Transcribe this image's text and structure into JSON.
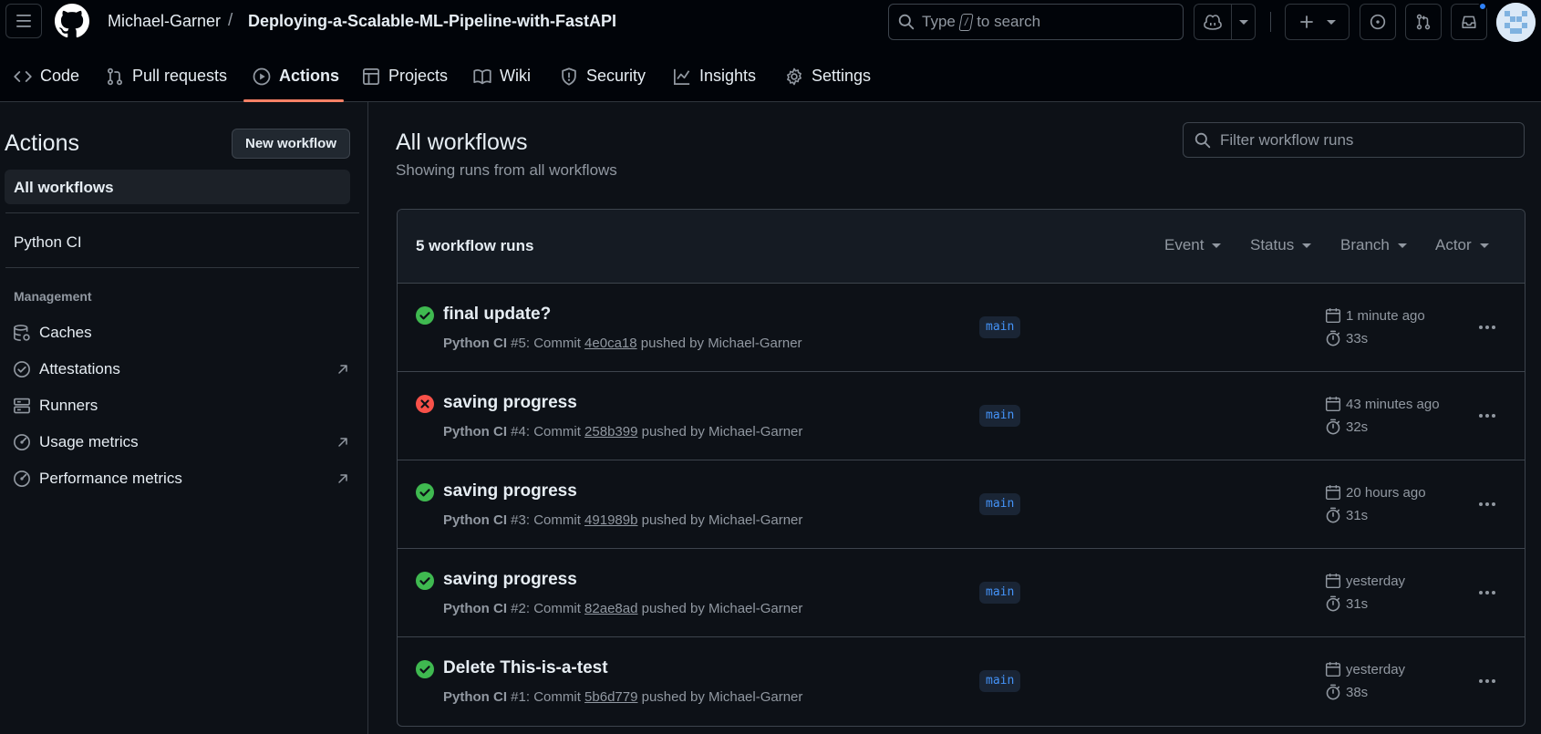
{
  "header": {
    "owner": "Michael-Garner",
    "separator": "/",
    "repo": "Deploying-a-Scalable-ML-Pipeline-with-FastAPI",
    "search": {
      "prefix": "Type",
      "key": "/",
      "suffix": "to search"
    }
  },
  "tabs": [
    {
      "label": "Code",
      "icon": "code-icon"
    },
    {
      "label": "Pull requests",
      "icon": "git-pull-request-icon"
    },
    {
      "label": "Actions",
      "icon": "play-icon",
      "active": true
    },
    {
      "label": "Projects",
      "icon": "table-icon"
    },
    {
      "label": "Wiki",
      "icon": "book-icon"
    },
    {
      "label": "Security",
      "icon": "shield-icon"
    },
    {
      "label": "Insights",
      "icon": "graph-icon"
    },
    {
      "label": "Settings",
      "icon": "gear-icon"
    }
  ],
  "sidebar": {
    "title": "Actions",
    "new_workflow": "New workflow",
    "all_workflows": "All workflows",
    "workflows": [
      "Python CI"
    ],
    "management_heading": "Management",
    "management": [
      {
        "label": "Caches",
        "icon": "database-icon",
        "external": false
      },
      {
        "label": "Attestations",
        "icon": "verified-icon",
        "external": true
      },
      {
        "label": "Runners",
        "icon": "server-icon",
        "external": false
      },
      {
        "label": "Usage metrics",
        "icon": "meter-icon",
        "external": true
      },
      {
        "label": "Performance metrics",
        "icon": "meter-icon",
        "external": true
      }
    ]
  },
  "main": {
    "title": "All workflows",
    "subtitle": "Showing runs from all workflows",
    "filter_placeholder": "Filter workflow runs",
    "runs_count": "5 workflow runs",
    "filters": [
      "Event",
      "Status",
      "Branch",
      "Actor"
    ],
    "runs": [
      {
        "status": "success",
        "title": "final update?",
        "workflow": "Python CI",
        "number": "#5",
        "sha": "4e0ca18",
        "actor": "Michael-Garner",
        "branch": "main",
        "when": "1 minute ago",
        "duration": "33s"
      },
      {
        "status": "failure",
        "title": "saving progress",
        "workflow": "Python CI",
        "number": "#4",
        "sha": "258b399",
        "actor": "Michael-Garner",
        "branch": "main",
        "when": "43 minutes ago",
        "duration": "32s"
      },
      {
        "status": "success",
        "title": "saving progress",
        "workflow": "Python CI",
        "number": "#3",
        "sha": "491989b",
        "actor": "Michael-Garner",
        "branch": "main",
        "when": "20 hours ago",
        "duration": "31s"
      },
      {
        "status": "success",
        "title": "saving progress",
        "workflow": "Python CI",
        "number": "#2",
        "sha": "82ae8ad",
        "actor": "Michael-Garner",
        "branch": "main",
        "when": "yesterday",
        "duration": "31s"
      },
      {
        "status": "success",
        "title": "Delete This-is-a-test",
        "workflow": "Python CI",
        "number": "#1",
        "sha": "5b6d779",
        "actor": "Michael-Garner",
        "branch": "main",
        "when": "yesterday",
        "duration": "38s"
      }
    ],
    "text_fragments": {
      "commit": "Commit",
      "pushed_by": "pushed by"
    }
  },
  "colors": {
    "success": "#3fb950",
    "failure": "#f85149",
    "accent": "#f78166",
    "link": "#4493f8"
  }
}
